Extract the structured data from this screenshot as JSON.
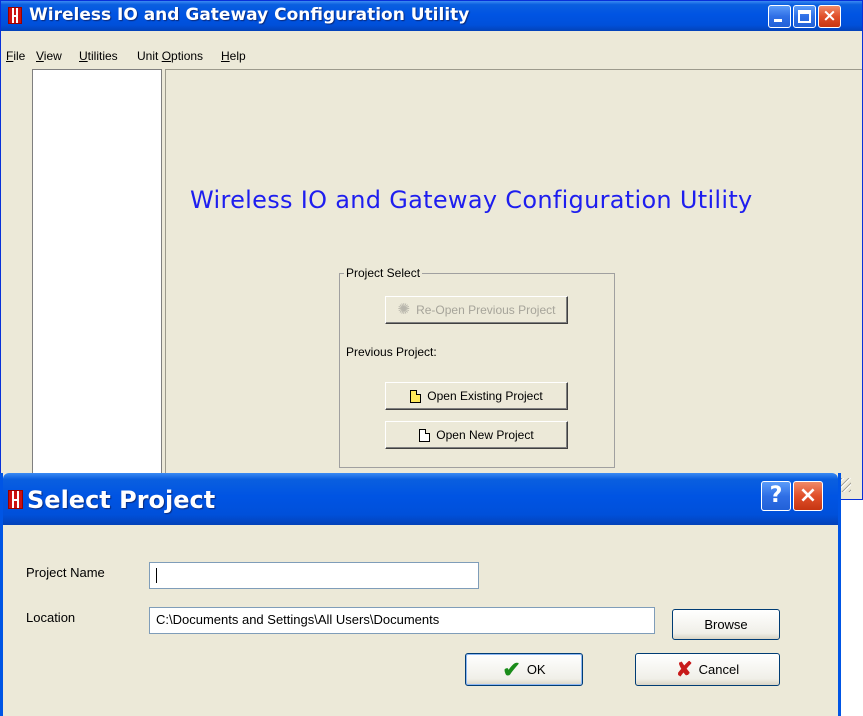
{
  "app": {
    "title": "Wireless IO and Gateway Configuration Utility",
    "heading": "Wireless IO and Gateway Configuration Utility"
  },
  "menu": {
    "items": [
      {
        "label_first": "F",
        "label_rest": "ile"
      },
      {
        "label_first": "V",
        "label_rest": "iew"
      },
      {
        "label_first": "U",
        "label_rest": "tilities"
      },
      {
        "label_pre": "Unit ",
        "label_first": "O",
        "label_rest": "ptions"
      },
      {
        "label_first": "H",
        "label_rest": "elp"
      }
    ]
  },
  "project_select": {
    "group_label": "Project Select",
    "reopen_label": "Re-Open Previous Project",
    "previous_label": "Previous Project:",
    "open_existing_label": "Open Existing Project",
    "open_new_label": "Open New Project"
  },
  "dialog": {
    "title": "Select Project",
    "help_glyph": "?",
    "close_glyph": "×",
    "project_name_label": "Project Name",
    "project_name_value": "",
    "location_label": "Location",
    "location_value": "C:\\Documents and Settings\\All Users\\Documents",
    "browse_label": "Browse",
    "ok_label": "OK",
    "cancel_label": "Cancel"
  },
  "icons": {
    "app_logo": "app-logo-icon",
    "reopen": "burst-icon",
    "open_existing": "document-icon",
    "open_new": "new-document-icon",
    "ok": "checkmark-icon",
    "cancel": "cross-icon"
  },
  "colors": {
    "titlebar": "#0054e3",
    "heading": "#1e1eef",
    "window_bg": "#ece9d8",
    "close_button": "#e0502a",
    "ok_check": "#1a8c1a",
    "cancel_cross": "#c81a1a"
  }
}
